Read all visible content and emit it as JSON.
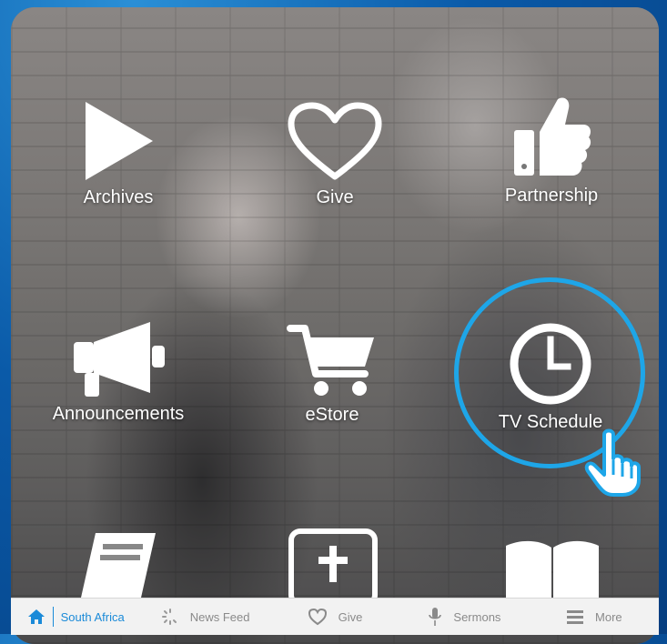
{
  "grid": {
    "items": [
      {
        "label": "Archives",
        "icon": "play-icon"
      },
      {
        "label": "Give",
        "icon": "heart-icon"
      },
      {
        "label": "Partnership",
        "icon": "thumbs-up-icon"
      },
      {
        "label": "Announcements",
        "icon": "megaphone-icon"
      },
      {
        "label": "eStore",
        "icon": "shopping-cart-icon"
      },
      {
        "label": "TV Schedule",
        "icon": "clock-icon"
      }
    ],
    "highlighted": "TV Schedule"
  },
  "tabbar": {
    "tabs": [
      {
        "label": "South Africa",
        "icon": "home-icon",
        "active": true
      },
      {
        "label": "News Feed",
        "icon": "loading-icon",
        "active": false
      },
      {
        "label": "Give",
        "icon": "heart-icon",
        "active": false
      },
      {
        "label": "Sermons",
        "icon": "microphone-icon",
        "active": false
      },
      {
        "label": "More",
        "icon": "menu-icon",
        "active": false
      }
    ]
  },
  "colors": {
    "accent": "#1a8ad8",
    "ring": "#1ea6e8",
    "background": "#0a5aa8"
  }
}
